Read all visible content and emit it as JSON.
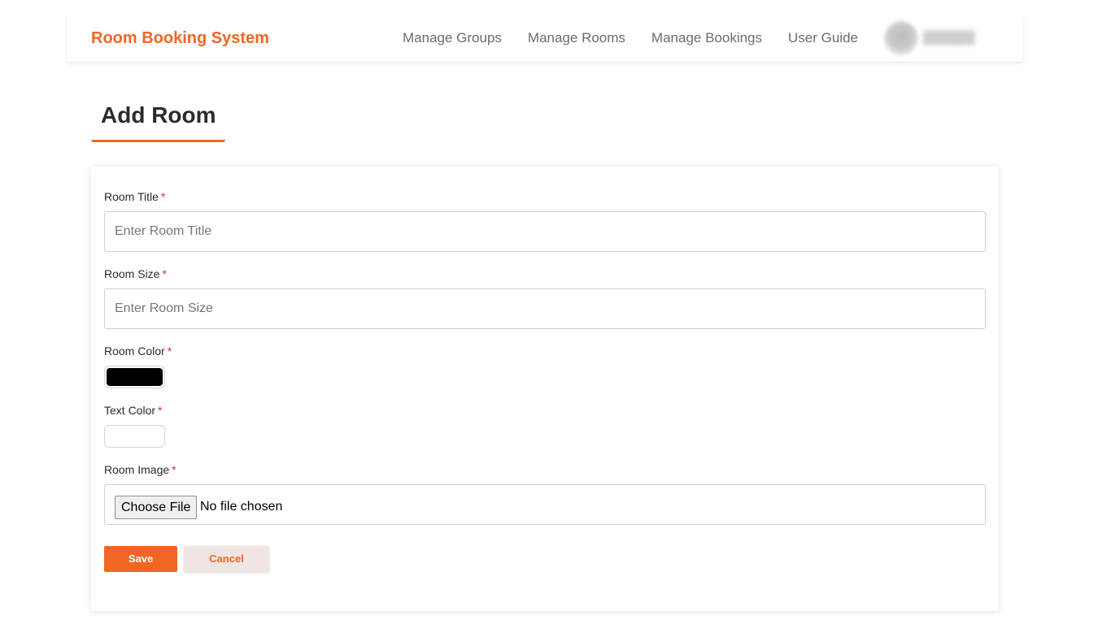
{
  "header": {
    "brand": "Room Booking System",
    "nav": [
      "Manage Groups",
      "Manage Rooms",
      "Manage Bookings",
      "User Guide"
    ]
  },
  "page": {
    "title": "Add Room"
  },
  "form": {
    "required_marker": "*",
    "room_title": {
      "label": "Room Title",
      "value": "",
      "placeholder": "Enter Room Title"
    },
    "room_size": {
      "label": "Room Size",
      "value": "",
      "placeholder": "Enter Room Size"
    },
    "room_color": {
      "label": "Room Color",
      "value": "#000000"
    },
    "text_color": {
      "label": "Text Color",
      "value": "#ffffff"
    },
    "room_image": {
      "label": "Room Image",
      "button_label": "Choose File",
      "status": "No file chosen"
    },
    "actions": {
      "save_label": "Save",
      "cancel_label": "Cancel"
    }
  },
  "colors": {
    "accent": "#f26522",
    "required": "#e0302f",
    "cancel_bg": "#efe6e3"
  },
  "icons": {
    "avatar": "user-avatar (blurred)"
  }
}
